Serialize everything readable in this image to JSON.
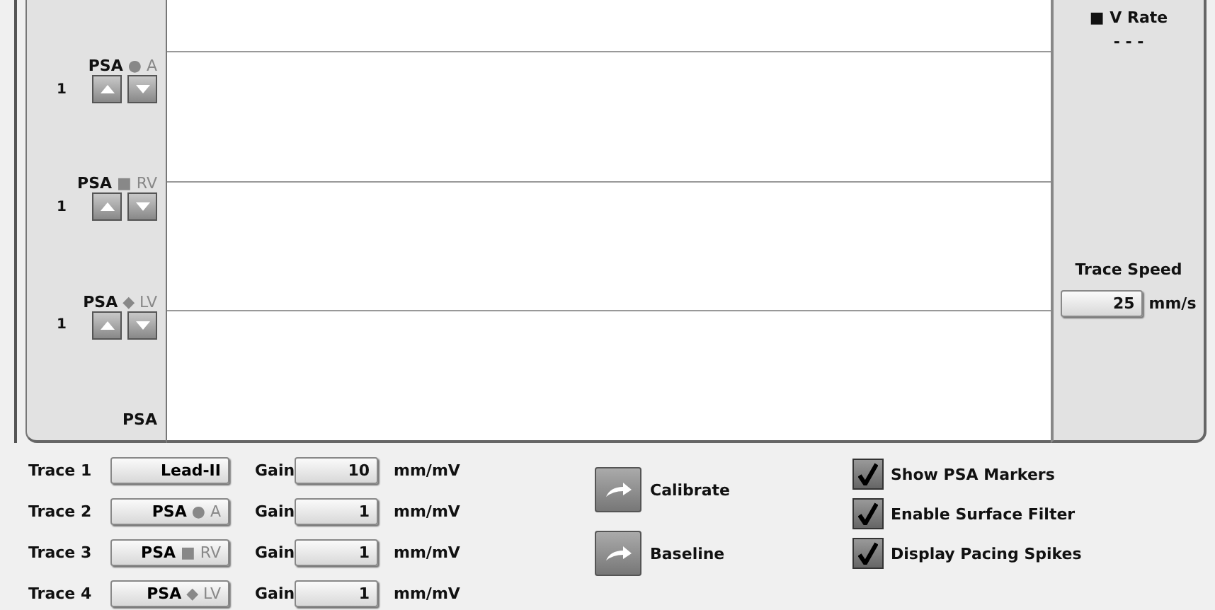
{
  "channels": [
    {
      "source": "PSA",
      "chamber": "● A",
      "gain": "1"
    },
    {
      "source": "PSA",
      "chamber": "■ RV",
      "gain": "1"
    },
    {
      "source": "PSA",
      "chamber": "◆ LV",
      "gain": "1"
    }
  ],
  "strip_footer": "PSA",
  "side_panel": {
    "rate_label": "■ V Rate",
    "rate_value": "- - -",
    "speed_label": "Trace Speed",
    "speed_value": "25",
    "speed_unit": "mm/s"
  },
  "traces": [
    {
      "label": "Trace 1",
      "source": "Lead-II",
      "gain_label": "Gain",
      "gain": "10",
      "unit": "mm/mV"
    },
    {
      "label": "Trace 2",
      "source": "PSA",
      "chamber": "● A",
      "gain_label": "Gain",
      "gain": "1",
      "unit": "mm/mV"
    },
    {
      "label": "Trace 3",
      "source": "PSA",
      "chamber": "■ RV",
      "gain_label": "Gain",
      "gain": "1",
      "unit": "mm/mV"
    },
    {
      "label": "Trace 4",
      "source": "PSA",
      "chamber": "◆ LV",
      "gain_label": "Gain",
      "gain": "1",
      "unit": "mm/mV"
    }
  ],
  "actions": [
    "Calibrate",
    "Baseline"
  ],
  "options": [
    {
      "label": "Show PSA Markers",
      "checked": true
    },
    {
      "label": "Enable Surface Filter",
      "checked": true
    },
    {
      "label": "Display Pacing Spikes",
      "checked": true
    }
  ]
}
